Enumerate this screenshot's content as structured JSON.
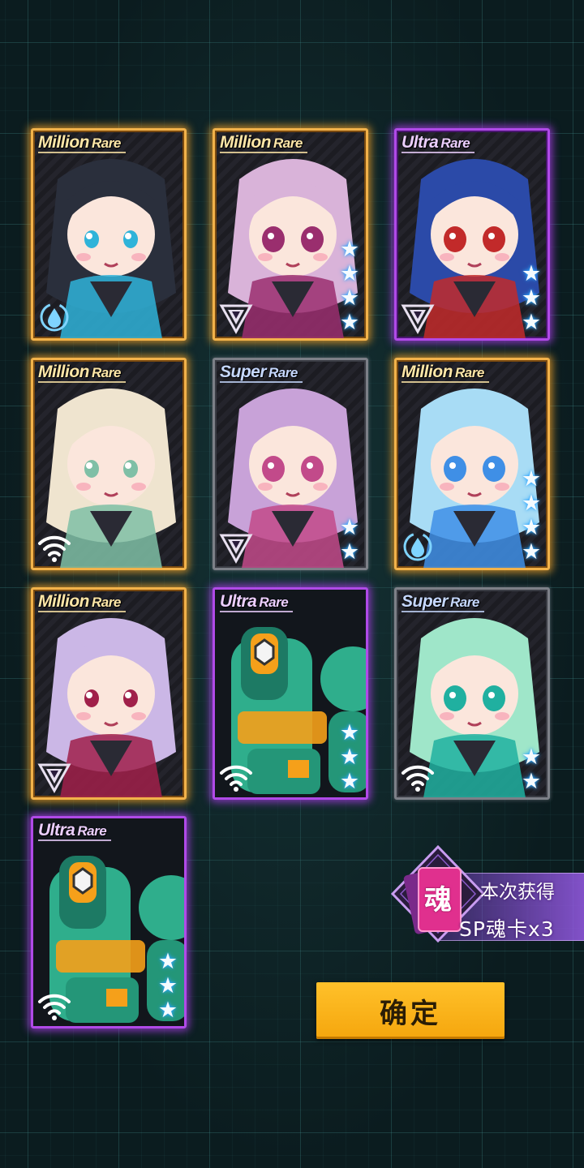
{
  "cards": [
    {
      "rarity_word": "Million",
      "rarity_suffix": "Rare",
      "tier": "million",
      "stars": 0,
      "class_icon": "water-drop-ring-icon",
      "art": "girl-black-hair",
      "hair": "#2a2f3c",
      "accent": "#2fb3d9"
    },
    {
      "rarity_word": "Million",
      "rarity_suffix": "Rare",
      "tier": "million",
      "stars": 4,
      "class_icon": "triangle-emblem-icon",
      "art": "chibi-horned-helmet",
      "hair": "#d9b3d9",
      "accent": "#9a2e6e"
    },
    {
      "rarity_word": "Ultra",
      "rarity_suffix": "Rare",
      "tier": "ultra",
      "stars": 3,
      "class_icon": "triangle-emblem-icon",
      "art": "chibi-blue-hair-ears",
      "hair": "#2b4aa8",
      "accent": "#c22a2a"
    },
    {
      "rarity_word": "Million",
      "rarity_suffix": "Rare",
      "tier": "million",
      "stars": 0,
      "class_icon": "wifi-signal-icon",
      "art": "girl-cream-hair-cap",
      "hair": "#efe4cf",
      "accent": "#7fbfa6"
    },
    {
      "rarity_word": "Super",
      "rarity_suffix": "Rare",
      "tier": "super",
      "stars": 2,
      "class_icon": "triangle-emblem-icon",
      "art": "chibi-pink-hat",
      "hair": "#c8a2d8",
      "accent": "#c24a8a"
    },
    {
      "rarity_word": "Million",
      "rarity_suffix": "Rare",
      "tier": "million",
      "stars": 4,
      "class_icon": "water-drop-ring-icon",
      "art": "chibi-ice-crown",
      "hair": "#a8dcf5",
      "accent": "#3f8fe6"
    },
    {
      "rarity_word": "Million",
      "rarity_suffix": "Rare",
      "tier": "million",
      "stars": 0,
      "class_icon": "triangle-emblem-icon",
      "art": "girl-lavender-twintails",
      "hair": "#cbb7e6",
      "accent": "#a0204a"
    },
    {
      "rarity_word": "Ultra",
      "rarity_suffix": "Rare",
      "tier": "ultra",
      "stars": 3,
      "class_icon": "wifi-signal-icon",
      "art": "green-mecha",
      "hair": "#2fae8c",
      "accent": "#f5a01a"
    },
    {
      "rarity_word": "Super",
      "rarity_suffix": "Rare",
      "tier": "super",
      "stars": 2,
      "class_icon": "wifi-signal-icon",
      "art": "chibi-mint-mecha-hat",
      "hair": "#9fe6c9",
      "accent": "#20b0a0"
    },
    {
      "rarity_word": "Ultra",
      "rarity_suffix": "Rare",
      "tier": "ultra",
      "stars": 3,
      "class_icon": "wifi-signal-icon",
      "art": "green-mecha",
      "hair": "#2fae8c",
      "accent": "#f5a01a"
    }
  ],
  "reward": {
    "soul_char": "魂",
    "title": "本次获得",
    "item": "SP魂卡x3"
  },
  "confirm_label": "确定"
}
